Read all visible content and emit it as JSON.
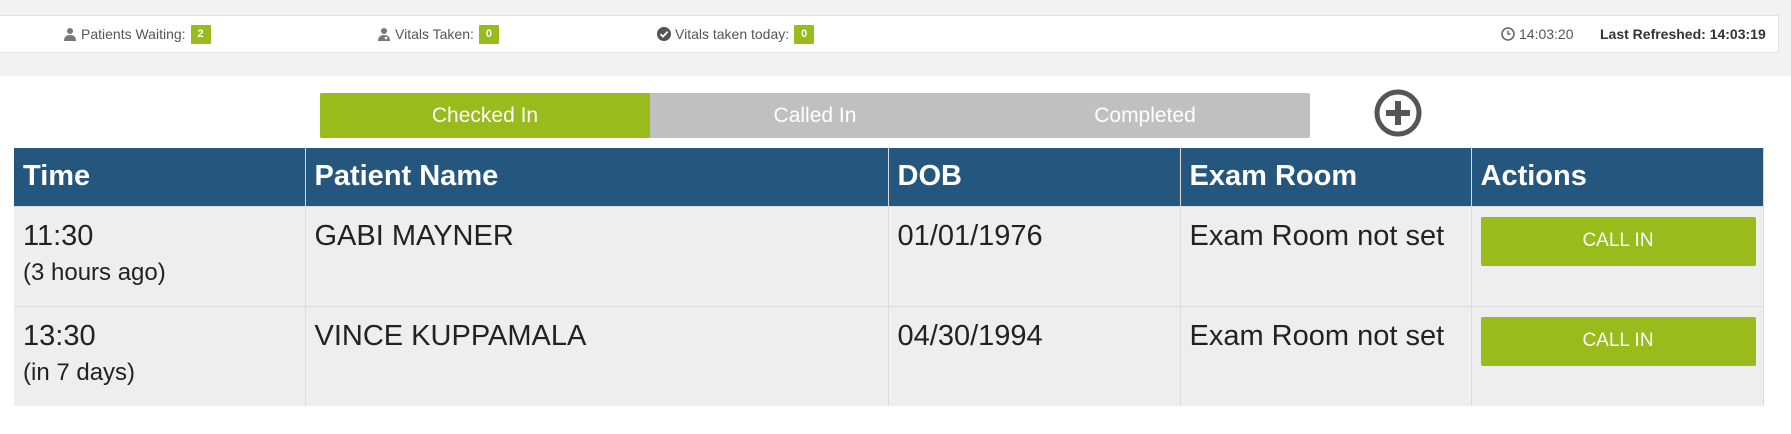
{
  "status": {
    "patients_waiting_label": "Patients Waiting:",
    "patients_waiting_count": "2",
    "vitals_taken_label": "Vitals Taken:",
    "vitals_taken_count": "0",
    "vitals_today_label": "Vitals taken today:",
    "vitals_today_count": "0",
    "clock": "14:03:20",
    "last_refreshed": "Last Refreshed: 14:03:19"
  },
  "tabs": [
    {
      "label": "Checked In",
      "active": true
    },
    {
      "label": "Called In",
      "active": false
    },
    {
      "label": "Completed",
      "active": false
    }
  ],
  "table": {
    "headers": [
      "Time",
      "Patient Name",
      "DOB",
      "Exam Room",
      "Actions"
    ],
    "rows": [
      {
        "time": "11:30",
        "relative": "(3 hours ago)",
        "name": "GABI MAYNER",
        "dob": "01/01/1976",
        "room": "Exam Room not set",
        "action": "CALL IN"
      },
      {
        "time": "13:30",
        "relative": "(in 7 days)",
        "name": "VINCE KUPPAMALA",
        "dob": "04/30/1994",
        "room": "Exam Room not set",
        "action": "CALL IN"
      }
    ]
  },
  "colors": {
    "accent": "#99bb1c",
    "header": "#25567e",
    "inactive_tab": "#c0c0c0"
  }
}
